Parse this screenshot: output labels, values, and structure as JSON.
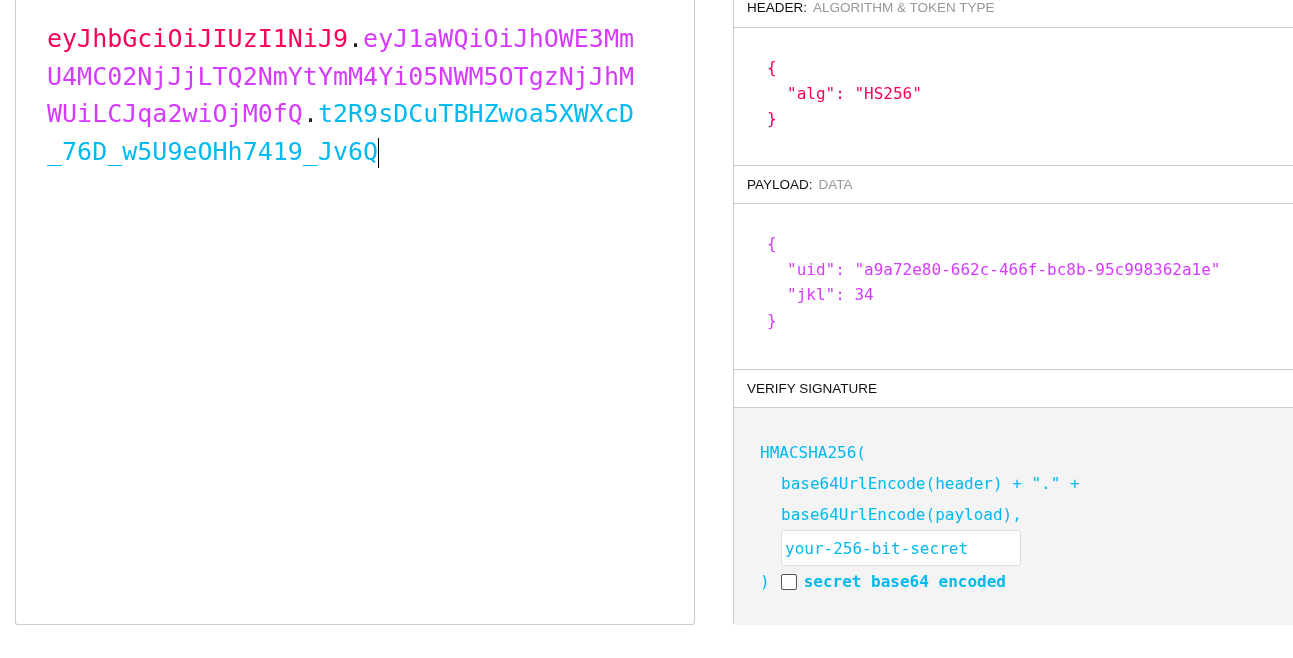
{
  "encoded": {
    "parts": [
      {
        "kind": "header",
        "text": "eyJhbGciOiJIUzI1NiJ9"
      },
      {
        "kind": "dot",
        "text": "."
      },
      {
        "kind": "payload",
        "text": "eyJ1aWQiOiJhOWE3MmU4MC02NjJjLTQ2NmYtYmM4Yi05NWM5OTgzNjJhMWUiLCJqa2wiOjM0fQ"
      },
      {
        "kind": "dot",
        "text": "."
      },
      {
        "kind": "signature",
        "text": "t2R9sDCuTBHZwoa5XWXcD_76D_w5U9eOHh7419_Jv6Q"
      }
    ]
  },
  "sections": [
    {
      "kind": "header",
      "title": "HEADER:",
      "subtitle": "ALGORITHM & TOKEN TYPE",
      "open": "{",
      "lines": [
        "\"alg\": \"HS256\""
      ],
      "close": "}"
    },
    {
      "kind": "payload",
      "title": "PAYLOAD:",
      "subtitle": "DATA",
      "open": "{",
      "lines": [
        "\"uid\": \"a9a72e80-662c-466f-bc8b-95c998362a1e\"",
        "\"jkl\": 34"
      ],
      "close": "}"
    },
    {
      "kind": "verify",
      "title": "VERIFY SIGNATURE",
      "func": "HMACSHA256(",
      "args": [
        "base64UrlEncode(header) + \".\" +",
        "base64UrlEncode(payload),"
      ],
      "secret": "your-256-bit-secret",
      "close": ")",
      "checkbox": {
        "label": "secret base64 encoded",
        "checked": false
      }
    }
  ]
}
